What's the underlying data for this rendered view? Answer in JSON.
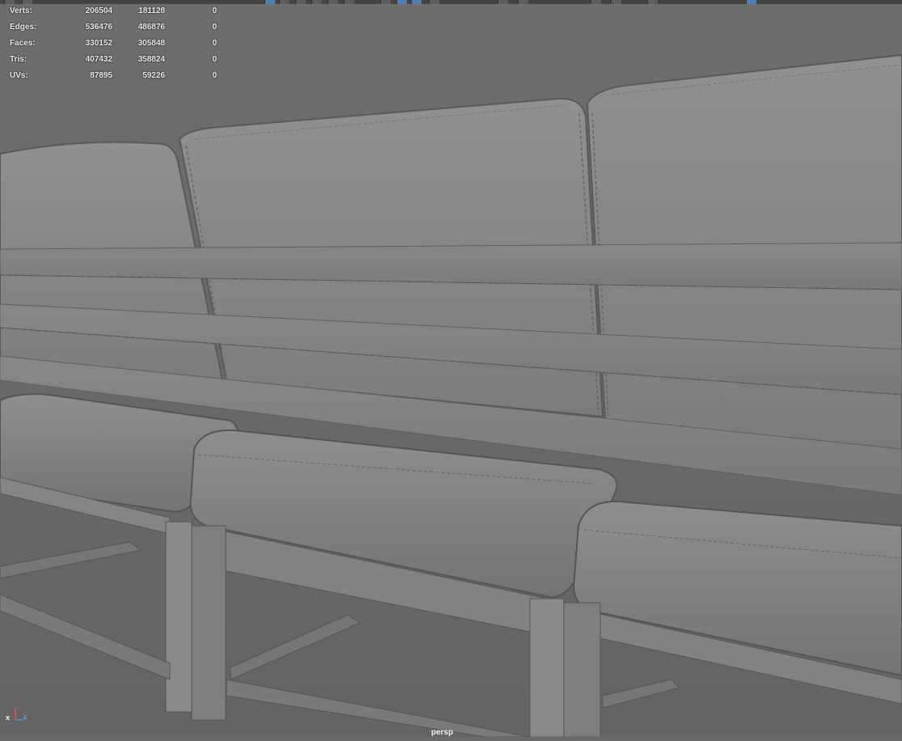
{
  "hud": {
    "rows": [
      {
        "label": "Verts:",
        "v1": "206504",
        "v2": "181128",
        "v3": "0"
      },
      {
        "label": "Edges:",
        "v1": "536476",
        "v2": "486876",
        "v3": "0"
      },
      {
        "label": "Faces:",
        "v1": "330152",
        "v2": "305848",
        "v3": "0"
      },
      {
        "label": "Tris:",
        "v1": "407432",
        "v2": "358824",
        "v3": "0"
      },
      {
        "label": "UVs:",
        "v1": "87895",
        "v2": "59226",
        "v3": "0"
      }
    ]
  },
  "viewport": {
    "camera": "persp"
  },
  "axis": {
    "x": "x",
    "z": "z"
  },
  "colors": {
    "background": "#6a6a6a",
    "model": "#8a8a8a",
    "accent": "#4f7fb0"
  }
}
